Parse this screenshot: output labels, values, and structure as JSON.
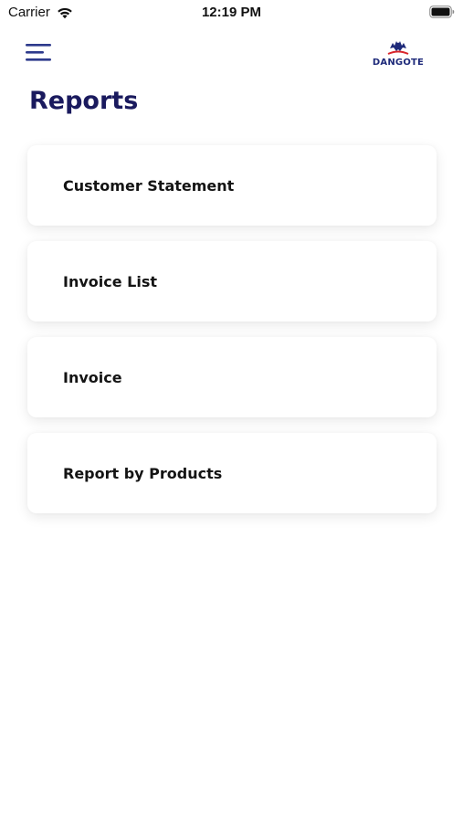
{
  "status_bar": {
    "carrier": "Carrier",
    "time": "12:19 PM"
  },
  "header": {
    "menu_icon": "hamburger-menu-icon",
    "logo_text": "DANGOTE",
    "logo_icon": "dangote-eagle-logo"
  },
  "page": {
    "title": "Reports"
  },
  "reports": [
    {
      "label": "Customer Statement"
    },
    {
      "label": "Invoice List"
    },
    {
      "label": "Invoice"
    },
    {
      "label": "Report by Products"
    }
  ],
  "colors": {
    "title": "#1a1a5e",
    "menu_icon": "#2d3a8c",
    "logo": "#1e2a7a",
    "logo_accent": "#d9262c",
    "card_text": "#141414",
    "background": "#ffffff"
  }
}
